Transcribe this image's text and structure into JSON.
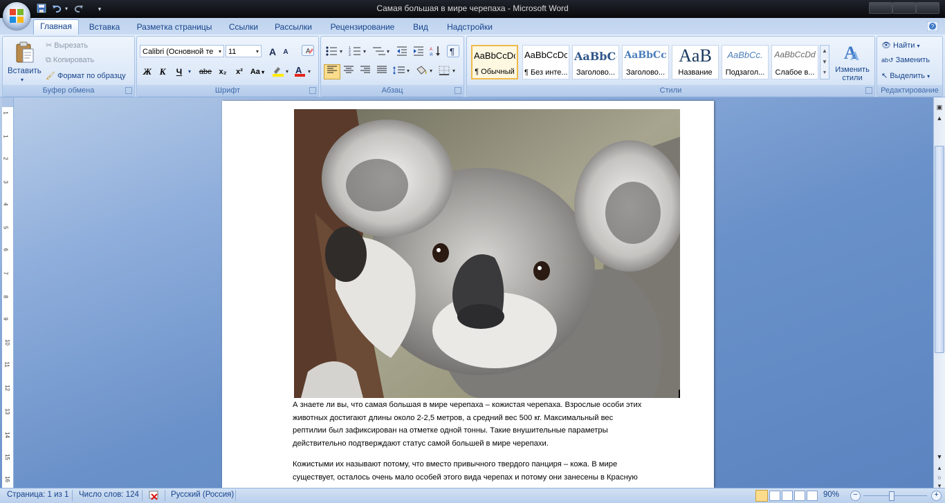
{
  "window": {
    "title": "Самая большая в мире черепаха - Microsoft Word"
  },
  "quick_access": {
    "items": [
      "save-icon",
      "undo-icon",
      "redo-icon",
      "customize-icon"
    ]
  },
  "tabs": [
    {
      "label": "Главная",
      "active": true
    },
    {
      "label": "Вставка"
    },
    {
      "label": "Разметка страницы"
    },
    {
      "label": "Ссылки"
    },
    {
      "label": "Рассылки"
    },
    {
      "label": "Рецензирование"
    },
    {
      "label": "Вид"
    },
    {
      "label": "Надстройки"
    }
  ],
  "ribbon": {
    "clipboard": {
      "label": "Буфер обмена",
      "paste": "Вставить",
      "cut": "Вырезать",
      "copy": "Копировать",
      "format_painter": "Формат по образцу"
    },
    "font": {
      "label": "Шрифт",
      "family": "Calibri (Основной те",
      "size": "11",
      "bold": "Ж",
      "italic": "К",
      "underline": "Ч",
      "strike": "abe",
      "subscript": "x₂",
      "superscript": "x²",
      "change_case": "Aa",
      "grow": "A",
      "shrink": "A"
    },
    "paragraph": {
      "label": "Абзац"
    },
    "styles": {
      "label": "Стили",
      "cards": [
        {
          "sample": "AaBbCcDc",
          "name": "¶ Обычный",
          "selected": true
        },
        {
          "sample": "AaBbCcDc",
          "name": "¶ Без инте..."
        },
        {
          "sample": "AaBbC(",
          "name": "Заголово..."
        },
        {
          "sample": "AaBbCc",
          "name": "Заголово..."
        },
        {
          "sample": "AaB",
          "name": "Название"
        },
        {
          "sample": "AaBbCc.",
          "name": "Подзагол..."
        },
        {
          "sample": "AaBbCcDd",
          "name": "Слабое в..."
        }
      ],
      "change_styles": "Изменить стили"
    },
    "editing": {
      "label": "Редактирование",
      "find": "Найти",
      "replace": "Заменить",
      "select": "Выделить"
    }
  },
  "document": {
    "paragraph1": [
      "А знаете ли вы, что самая большая в мире черепаха – кожистая черепаха.  Взрослые особи этих",
      "животных достигают длины около 2-2,5 метров, а средний вес 500 кг. Максимальный вес",
      "рептилии был зафиксирован на отметке одной тонны. Такие  внушительные параметры",
      "действительно подтверждают статус самой большей в мире черепахи."
    ],
    "paragraph2": [
      "Кожистыми их называют потому, что вместо привычного твердого панциря – кожа. В мире",
      "существует, осталось очень мало особей этого вида черепах и потому они занесены в Красную"
    ]
  },
  "ruler": {
    "numbers": [
      "1",
      "1",
      "2",
      "3",
      "4",
      "5",
      "6",
      "7",
      "8",
      "9",
      "10",
      "11",
      "12",
      "13",
      "14",
      "15",
      "16"
    ]
  },
  "statusbar": {
    "page": "Страница: 1 из 1",
    "words": "Число слов: 124",
    "language": "Русский (Россия)",
    "zoom": "90%"
  }
}
